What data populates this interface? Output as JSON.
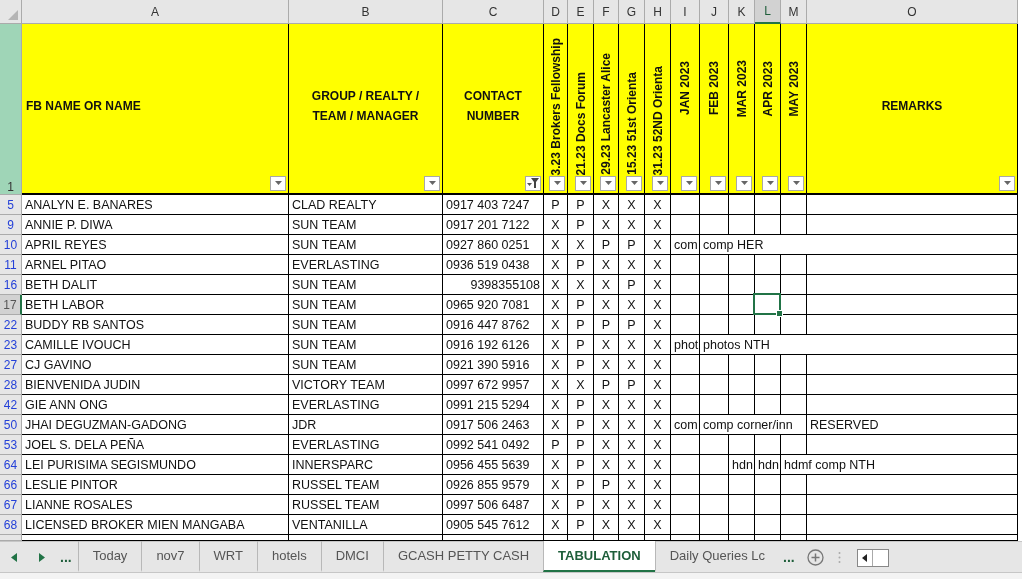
{
  "columns": [
    {
      "letter": "A",
      "selected": false
    },
    {
      "letter": "B",
      "selected": false
    },
    {
      "letter": "C",
      "selected": false
    },
    {
      "letter": "D",
      "selected": false
    },
    {
      "letter": "E",
      "selected": false
    },
    {
      "letter": "F",
      "selected": false
    },
    {
      "letter": "G",
      "selected": false
    },
    {
      "letter": "H",
      "selected": false
    },
    {
      "letter": "I",
      "selected": false
    },
    {
      "letter": "J",
      "selected": false
    },
    {
      "letter": "K",
      "selected": false
    },
    {
      "letter": "L",
      "selected": true
    },
    {
      "letter": "M",
      "selected": false
    },
    {
      "letter": "O",
      "selected": false
    }
  ],
  "header_row": {
    "number": "1",
    "cells": [
      {
        "text": "FB NAME OR NAME",
        "kind": "left",
        "filtered": false
      },
      {
        "text": "GROUP / REALTY / TEAM / MANAGER",
        "kind": "center",
        "filtered": false
      },
      {
        "text": "CONTACT NUMBER",
        "kind": "center",
        "filtered": true
      },
      {
        "text": "3.23 Brokers Fellowship",
        "kind": "vertical-cut",
        "filtered": false
      },
      {
        "text": "21.23 Docs Forum",
        "kind": "vertical-cut",
        "filtered": false
      },
      {
        "text": "29.23 Lancaster Alice",
        "kind": "vertical-cut",
        "filtered": false
      },
      {
        "text": "15.23 51st Orienta",
        "kind": "vertical-cut",
        "filtered": false
      },
      {
        "text": "31.23 52ND Orienta",
        "kind": "vertical-cut",
        "filtered": false
      },
      {
        "text": "JAN 2023",
        "kind": "vertical",
        "filtered": false
      },
      {
        "text": "FEB 2023",
        "kind": "vertical",
        "filtered": false
      },
      {
        "text": "MAR 2023",
        "kind": "vertical",
        "filtered": false
      },
      {
        "text": "APR 2023",
        "kind": "vertical",
        "filtered": false
      },
      {
        "text": "MAY 2023",
        "kind": "vertical",
        "filtered": false
      },
      {
        "text": "REMARKS",
        "kind": "center",
        "filtered": false
      }
    ]
  },
  "rows": [
    {
      "number": "5",
      "selected": false,
      "name": "ANALYN E. BANARES",
      "group": "CLAD REALTY",
      "contact": "0917 403 7247",
      "contact_numeric": false,
      "marks": [
        "P",
        "P",
        "X",
        "X",
        "X"
      ],
      "notes": {}
    },
    {
      "number": "9",
      "selected": false,
      "name": "ANNIE P. DIWA",
      "group": "SUN TEAM",
      "contact": "0917 201 7122",
      "contact_numeric": false,
      "marks": [
        "X",
        "P",
        "X",
        "X",
        "X"
      ],
      "notes": {}
    },
    {
      "number": "10",
      "selected": false,
      "name": "APRIL REYES",
      "group": "SUN TEAM",
      "contact": "0927 860 0251",
      "contact_numeric": false,
      "marks": [
        "X",
        "X",
        "P",
        "P",
        "X"
      ],
      "notes": {
        "jan_2023": "com",
        "feb_2023": "comp HER"
      }
    },
    {
      "number": "11",
      "selected": false,
      "name": "ARNEL PITAO",
      "group": "EVERLASTING",
      "contact": "0936 519 0438",
      "contact_numeric": false,
      "marks": [
        "X",
        "P",
        "X",
        "X",
        "X"
      ],
      "notes": {}
    },
    {
      "number": "16",
      "selected": false,
      "name": "BETH DALIT",
      "group": "SUN TEAM",
      "contact": "9398355108",
      "contact_numeric": true,
      "marks": [
        "X",
        "X",
        "X",
        "P",
        "X"
      ],
      "notes": {}
    },
    {
      "number": "17",
      "selected": true,
      "name": "BETH LABOR",
      "group": "SUN TEAM",
      "contact": "0965 920 7081",
      "contact_numeric": false,
      "marks": [
        "X",
        "P",
        "X",
        "X",
        "X"
      ],
      "notes": {}
    },
    {
      "number": "22",
      "selected": false,
      "name": "BUDDY RB SANTOS",
      "group": "SUN TEAM",
      "contact": "0916 447 8762",
      "contact_numeric": false,
      "marks": [
        "X",
        "P",
        "P",
        "P",
        "X"
      ],
      "notes": {}
    },
    {
      "number": "23",
      "selected": false,
      "name": "CAMILLE IVOUCH",
      "group": "SUN TEAM",
      "contact": "0916 192 6126",
      "contact_numeric": false,
      "marks": [
        "X",
        "P",
        "X",
        "X",
        "X"
      ],
      "notes": {
        "jan_2023": "phot",
        "feb_2023": "photos NTH"
      }
    },
    {
      "number": "27",
      "selected": false,
      "name": "CJ GAVINO",
      "group": "SUN TEAM",
      "contact": "0921 390 5916",
      "contact_numeric": false,
      "marks": [
        "X",
        "P",
        "X",
        "X",
        "X"
      ],
      "notes": {}
    },
    {
      "number": "28",
      "selected": false,
      "name": "BIENVENIDA JUDIN",
      "group": "VICTORY TEAM",
      "contact": "0997 672 9957",
      "contact_numeric": false,
      "marks": [
        "X",
        "X",
        "P",
        "P",
        "X"
      ],
      "notes": {}
    },
    {
      "number": "42",
      "selected": false,
      "name": "GIE ANN ONG",
      "group": "EVERLASTING",
      "contact": "0991 215 5294",
      "contact_numeric": false,
      "marks": [
        "X",
        "P",
        "X",
        "X",
        "X"
      ],
      "notes": {}
    },
    {
      "number": "50",
      "selected": false,
      "name": "JHAI DEGUZMAN-GADONG",
      "group": "JDR",
      "contact": "0917 506 2463",
      "contact_numeric": false,
      "marks": [
        "X",
        "P",
        "X",
        "X",
        "X"
      ],
      "notes": {
        "jan_2023": "com",
        "feb_2023": "comp corner/inn",
        "remarks": "RESERVED"
      }
    },
    {
      "number": "53",
      "selected": false,
      "name": "JOEL S. DELA PEÑA",
      "group": "EVERLASTING",
      "contact": "0992 541 0492",
      "contact_numeric": false,
      "marks": [
        "P",
        "P",
        "X",
        "X",
        "X"
      ],
      "notes": {}
    },
    {
      "number": "64",
      "selected": false,
      "name": "LEI PURISIMA SEGISMUNDO",
      "group": "INNERSPARC",
      "contact": "0956 455 5639",
      "contact_numeric": false,
      "marks": [
        "X",
        "P",
        "X",
        "X",
        "X"
      ],
      "notes": {
        "mar_2023": "hdn",
        "apr_2023": "hdn",
        "may_2023": "hdmf comp NTH"
      }
    },
    {
      "number": "66",
      "selected": false,
      "name": "LESLIE PINTOR",
      "group": "RUSSEL TEAM",
      "contact": "0926 855 9579",
      "contact_numeric": false,
      "marks": [
        "X",
        "P",
        "P",
        "X",
        "X"
      ],
      "notes": {}
    },
    {
      "number": "67",
      "selected": false,
      "name": "LIANNE ROSALES",
      "group": "RUSSEL TEAM",
      "contact": "0997 506 6487",
      "contact_numeric": false,
      "marks": [
        "X",
        "P",
        "X",
        "X",
        "X"
      ],
      "notes": {}
    },
    {
      "number": "68",
      "selected": false,
      "name": "LICENSED BROKER MIEN MANGABA",
      "group": "VENTANILLA",
      "contact": "0905 545 7612",
      "contact_numeric": false,
      "marks": [
        "X",
        "P",
        "X",
        "X",
        "X"
      ],
      "notes": {}
    }
  ],
  "sheet_tabs": {
    "more_left": "...",
    "more_right": "...",
    "tabs": [
      {
        "label": "Today",
        "selected": false
      },
      {
        "label": "nov7",
        "selected": false
      },
      {
        "label": "WRT",
        "selected": false
      },
      {
        "label": "hotels",
        "selected": false
      },
      {
        "label": "DMCI",
        "selected": false
      },
      {
        "label": "GCASH PETTY CASH",
        "selected": false
      },
      {
        "label": "TABULATION",
        "selected": true
      },
      {
        "label": "Daily Queries Lc",
        "selected": false
      }
    ]
  }
}
